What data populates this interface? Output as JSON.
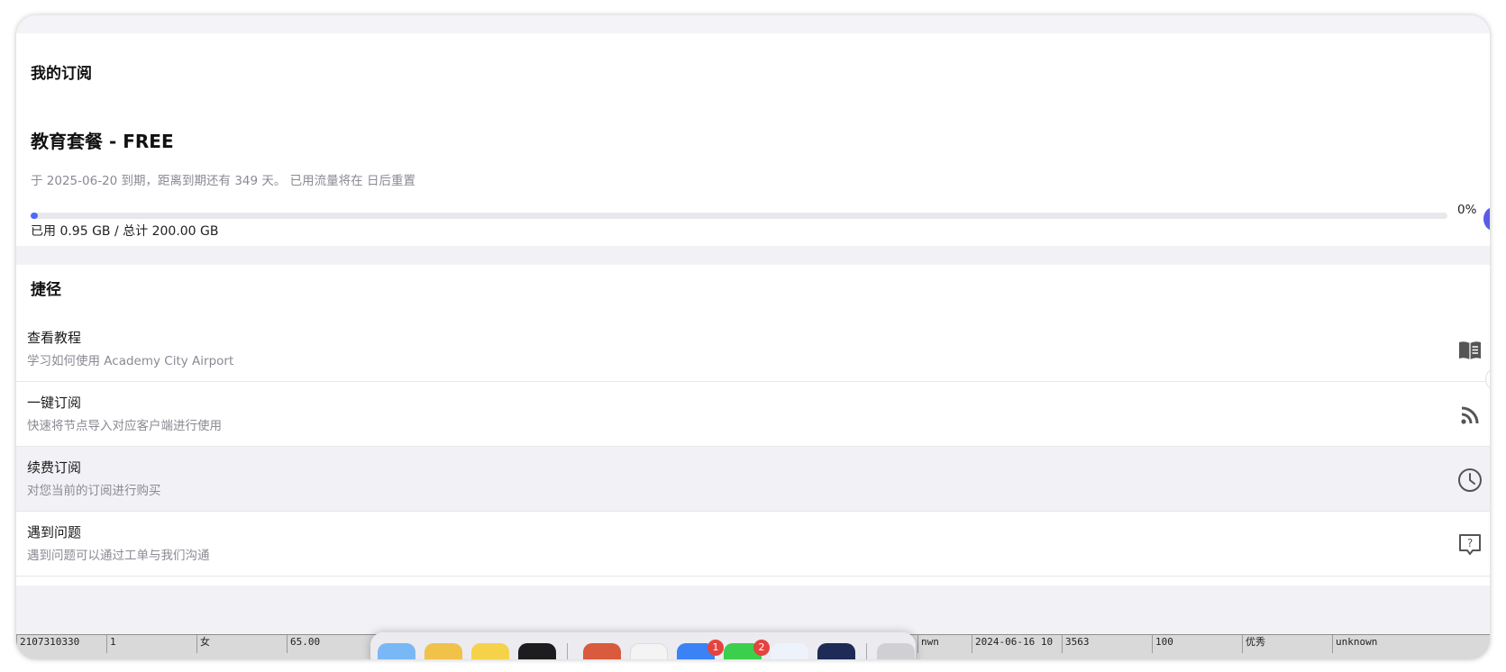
{
  "subscription": {
    "section_title": "我的订阅",
    "plan_title": "教育套餐 - FREE",
    "expiry_text": "于 2025-06-20 到期，距离到期还有 349 天。 已用流量将在 日后重置",
    "usage_percent_label": "0%",
    "usage_fraction": 0.005,
    "usage_text": "已用 0.95 GB / 总计 200.00 GB"
  },
  "shortcuts": {
    "section_title": "捷径",
    "items": [
      {
        "title": "查看教程",
        "subtitle": "学习如何使用 Academy City Airport",
        "icon": "book-icon"
      },
      {
        "title": "一键订阅",
        "subtitle": "快速将节点导入对应客户端进行使用",
        "icon": "rss-icon"
      },
      {
        "title": "续费订阅",
        "subtitle": "对您当前的订阅进行购买",
        "icon": "clock-icon"
      },
      {
        "title": "遇到问题",
        "subtitle": "遇到问题可以通过工单与我们沟通",
        "icon": "question-chat-icon"
      }
    ]
  },
  "background_row": {
    "cells": [
      "2107310330",
      "1",
      "女",
      "65.00",
      "nwn",
      "2024-06-16 10",
      "3563",
      "100",
      "优秀",
      "unknown"
    ]
  },
  "dock": {
    "badges": [
      "1",
      "2"
    ]
  },
  "colors": {
    "accent": "#4a6cf7",
    "page_bg": "#f2f2f6",
    "badge": "#e5433f"
  }
}
